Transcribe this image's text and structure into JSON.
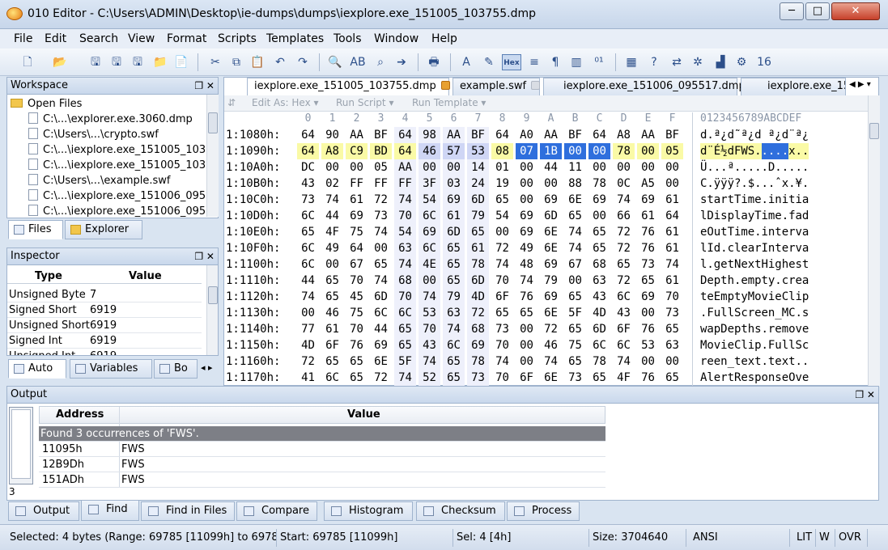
{
  "window": {
    "title": "010 Editor - C:\\Users\\ADMIN\\Desktop\\ie-dumps\\dumps\\iexplore.exe_151005_103755.dmp",
    "min_label": "─",
    "max_label": "□",
    "close_label": "✕"
  },
  "menu": [
    "File",
    "Edit",
    "Search",
    "View",
    "Format",
    "Scripts",
    "Templates",
    "Tools",
    "Window",
    "Help"
  ],
  "toolbar": {
    "hex_label": "Hex"
  },
  "workspace": {
    "title": "Workspace",
    "panel_buttons": "❐ ✕",
    "open_files_label": "Open Files",
    "files": [
      "C:\\...\\explorer.exe.3060.dmp",
      "C:\\Users\\...\\crypto.swf",
      "C:\\...\\iexplore.exe_151005_103",
      "C:\\...\\iexplore.exe_151005_103",
      "C:\\Users\\...\\example.swf",
      "C:\\...\\iexplore.exe_151006_095",
      "C:\\...\\iexplore.exe_151006_095"
    ],
    "tabs": [
      "Files",
      "Explorer"
    ]
  },
  "inspector": {
    "title": "Inspector",
    "panel_buttons": "❐ ✕",
    "col_type": "Type",
    "col_value": "Value",
    "rows": [
      {
        "type": "Unsigned Byte",
        "value": "7"
      },
      {
        "type": "Signed Short",
        "value": "6919"
      },
      {
        "type": "Unsigned Short",
        "value": "6919"
      },
      {
        "type": "Signed Int",
        "value": "6919"
      },
      {
        "type": "Unsigned Int",
        "value": "6919"
      }
    ],
    "tabs": [
      "Auto",
      "Variables",
      "Bo"
    ]
  },
  "editor": {
    "tabs": [
      "iexplore.exe_151005_103755.dmp",
      "example.swf",
      "iexplore.exe_151006_095517.dmp",
      "iexplore.exe_15"
    ],
    "tab_nav": "◀ ▶ ▾",
    "toolbar_items": [
      "Edit As: Hex ▾",
      "Run Script ▾",
      "Run Template ▾"
    ],
    "toolbar_arrow": "⇵",
    "col_header": [
      "0",
      "1",
      "2",
      "3",
      "4",
      "5",
      "6",
      "7",
      "8",
      "9",
      "A",
      "B",
      "C",
      "D",
      "E",
      "F"
    ],
    "ascii_header": "0123456789ABCDEF",
    "rows": [
      {
        "addr": "1:1080h:",
        "bytes": [
          "64",
          "90",
          "AA",
          "BF",
          "64",
          "98",
          "AA",
          "BF",
          "64",
          "A0",
          "AA",
          "BF",
          "64",
          "A8",
          "AA",
          "BF"
        ],
        "ascii": "d.ª¿d˜ª¿d ª¿d¨ª¿"
      },
      {
        "addr": "1:1090h:",
        "bytes": [
          "64",
          "A8",
          "C9",
          "BD",
          "64",
          "46",
          "57",
          "53",
          "08",
          "07",
          "1B",
          "00",
          "00",
          "78",
          "00",
          "05"
        ],
        "ascii": "d¨É½dFWS.....x.."
      },
      {
        "addr": "1:10A0h:",
        "bytes": [
          "DC",
          "00",
          "00",
          "05",
          "AA",
          "00",
          "00",
          "14",
          "01",
          "00",
          "44",
          "11",
          "00",
          "00",
          "00",
          "00"
        ],
        "ascii": "Ü...ª.....D....."
      },
      {
        "addr": "1:10B0h:",
        "bytes": [
          "43",
          "02",
          "FF",
          "FF",
          "FF",
          "3F",
          "03",
          "24",
          "19",
          "00",
          "00",
          "88",
          "78",
          "0C",
          "A5",
          "00"
        ],
        "ascii": "C.ÿÿÿ?.$...ˆx.¥."
      },
      {
        "addr": "1:10C0h:",
        "bytes": [
          "73",
          "74",
          "61",
          "72",
          "74",
          "54",
          "69",
          "6D",
          "65",
          "00",
          "69",
          "6E",
          "69",
          "74",
          "69",
          "61"
        ],
        "ascii": "startTime.initia"
      },
      {
        "addr": "1:10D0h:",
        "bytes": [
          "6C",
          "44",
          "69",
          "73",
          "70",
          "6C",
          "61",
          "79",
          "54",
          "69",
          "6D",
          "65",
          "00",
          "66",
          "61",
          "64"
        ],
        "ascii": "lDisplayTime.fad"
      },
      {
        "addr": "1:10E0h:",
        "bytes": [
          "65",
          "4F",
          "75",
          "74",
          "54",
          "69",
          "6D",
          "65",
          "00",
          "69",
          "6E",
          "74",
          "65",
          "72",
          "76",
          "61"
        ],
        "ascii": "eOutTime.interva"
      },
      {
        "addr": "1:10F0h:",
        "bytes": [
          "6C",
          "49",
          "64",
          "00",
          "63",
          "6C",
          "65",
          "61",
          "72",
          "49",
          "6E",
          "74",
          "65",
          "72",
          "76",
          "61"
        ],
        "ascii": "lId.clearInterva"
      },
      {
        "addr": "1:1100h:",
        "bytes": [
          "6C",
          "00",
          "67",
          "65",
          "74",
          "4E",
          "65",
          "78",
          "74",
          "48",
          "69",
          "67",
          "68",
          "65",
          "73",
          "74"
        ],
        "ascii": "l.getNextHighest"
      },
      {
        "addr": "1:1110h:",
        "bytes": [
          "44",
          "65",
          "70",
          "74",
          "68",
          "00",
          "65",
          "6D",
          "70",
          "74",
          "79",
          "00",
          "63",
          "72",
          "65",
          "61"
        ],
        "ascii": "Depth.empty.crea"
      },
      {
        "addr": "1:1120h:",
        "bytes": [
          "74",
          "65",
          "45",
          "6D",
          "70",
          "74",
          "79",
          "4D",
          "6F",
          "76",
          "69",
          "65",
          "43",
          "6C",
          "69",
          "70"
        ],
        "ascii": "teEmptyMovieClip"
      },
      {
        "addr": "1:1130h:",
        "bytes": [
          "00",
          "46",
          "75",
          "6C",
          "6C",
          "53",
          "63",
          "72",
          "65",
          "65",
          "6E",
          "5F",
          "4D",
          "43",
          "00",
          "73"
        ],
        "ascii": ".FullScreen_MC.s"
      },
      {
        "addr": "1:1140h:",
        "bytes": [
          "77",
          "61",
          "70",
          "44",
          "65",
          "70",
          "74",
          "68",
          "73",
          "00",
          "72",
          "65",
          "6D",
          "6F",
          "76",
          "65"
        ],
        "ascii": "wapDepths.remove"
      },
      {
        "addr": "1:1150h:",
        "bytes": [
          "4D",
          "6F",
          "76",
          "69",
          "65",
          "43",
          "6C",
          "69",
          "70",
          "00",
          "46",
          "75",
          "6C",
          "6C",
          "53",
          "63"
        ],
        "ascii": "MovieClip.FullSc"
      },
      {
        "addr": "1:1160h:",
        "bytes": [
          "72",
          "65",
          "65",
          "6E",
          "5F",
          "74",
          "65",
          "78",
          "74",
          "00",
          "74",
          "65",
          "78",
          "74",
          "00",
          "00"
        ],
        "ascii": "reen_text.text.."
      },
      {
        "addr": "1:1170h:",
        "bytes": [
          "41",
          "6C",
          "65",
          "72",
          "74",
          "52",
          "65",
          "73",
          "70",
          "6F",
          "6E",
          "73",
          "65",
          "4F",
          "76",
          "65"
        ],
        "ascii": "AlertResponseOve"
      }
    ]
  },
  "output": {
    "title": "Output",
    "panel_buttons": "❐ ✕",
    "col_address": "Address",
    "col_value": "Value",
    "summary": "Found 3 occurrences of 'FWS'.",
    "rows": [
      {
        "address": "11095h",
        "value": "FWS"
      },
      {
        "address": "12B9Dh",
        "value": "FWS"
      },
      {
        "address": "151ADh",
        "value": "FWS"
      }
    ],
    "count": "3",
    "tabs": [
      "Output",
      "Find",
      "Find in Files",
      "Compare",
      "Histogram",
      "Checksum",
      "Process"
    ]
  },
  "status": {
    "selected": "Selected: 4 bytes (Range: 69785 [11099h] to 6978",
    "start": "Start: 69785 [11099h]",
    "sel": "Sel: 4 [4h]",
    "size": "Size: 3704640",
    "encoding": "ANSI",
    "lit": "LIT",
    "w": "W",
    "ovr": "OVR"
  }
}
